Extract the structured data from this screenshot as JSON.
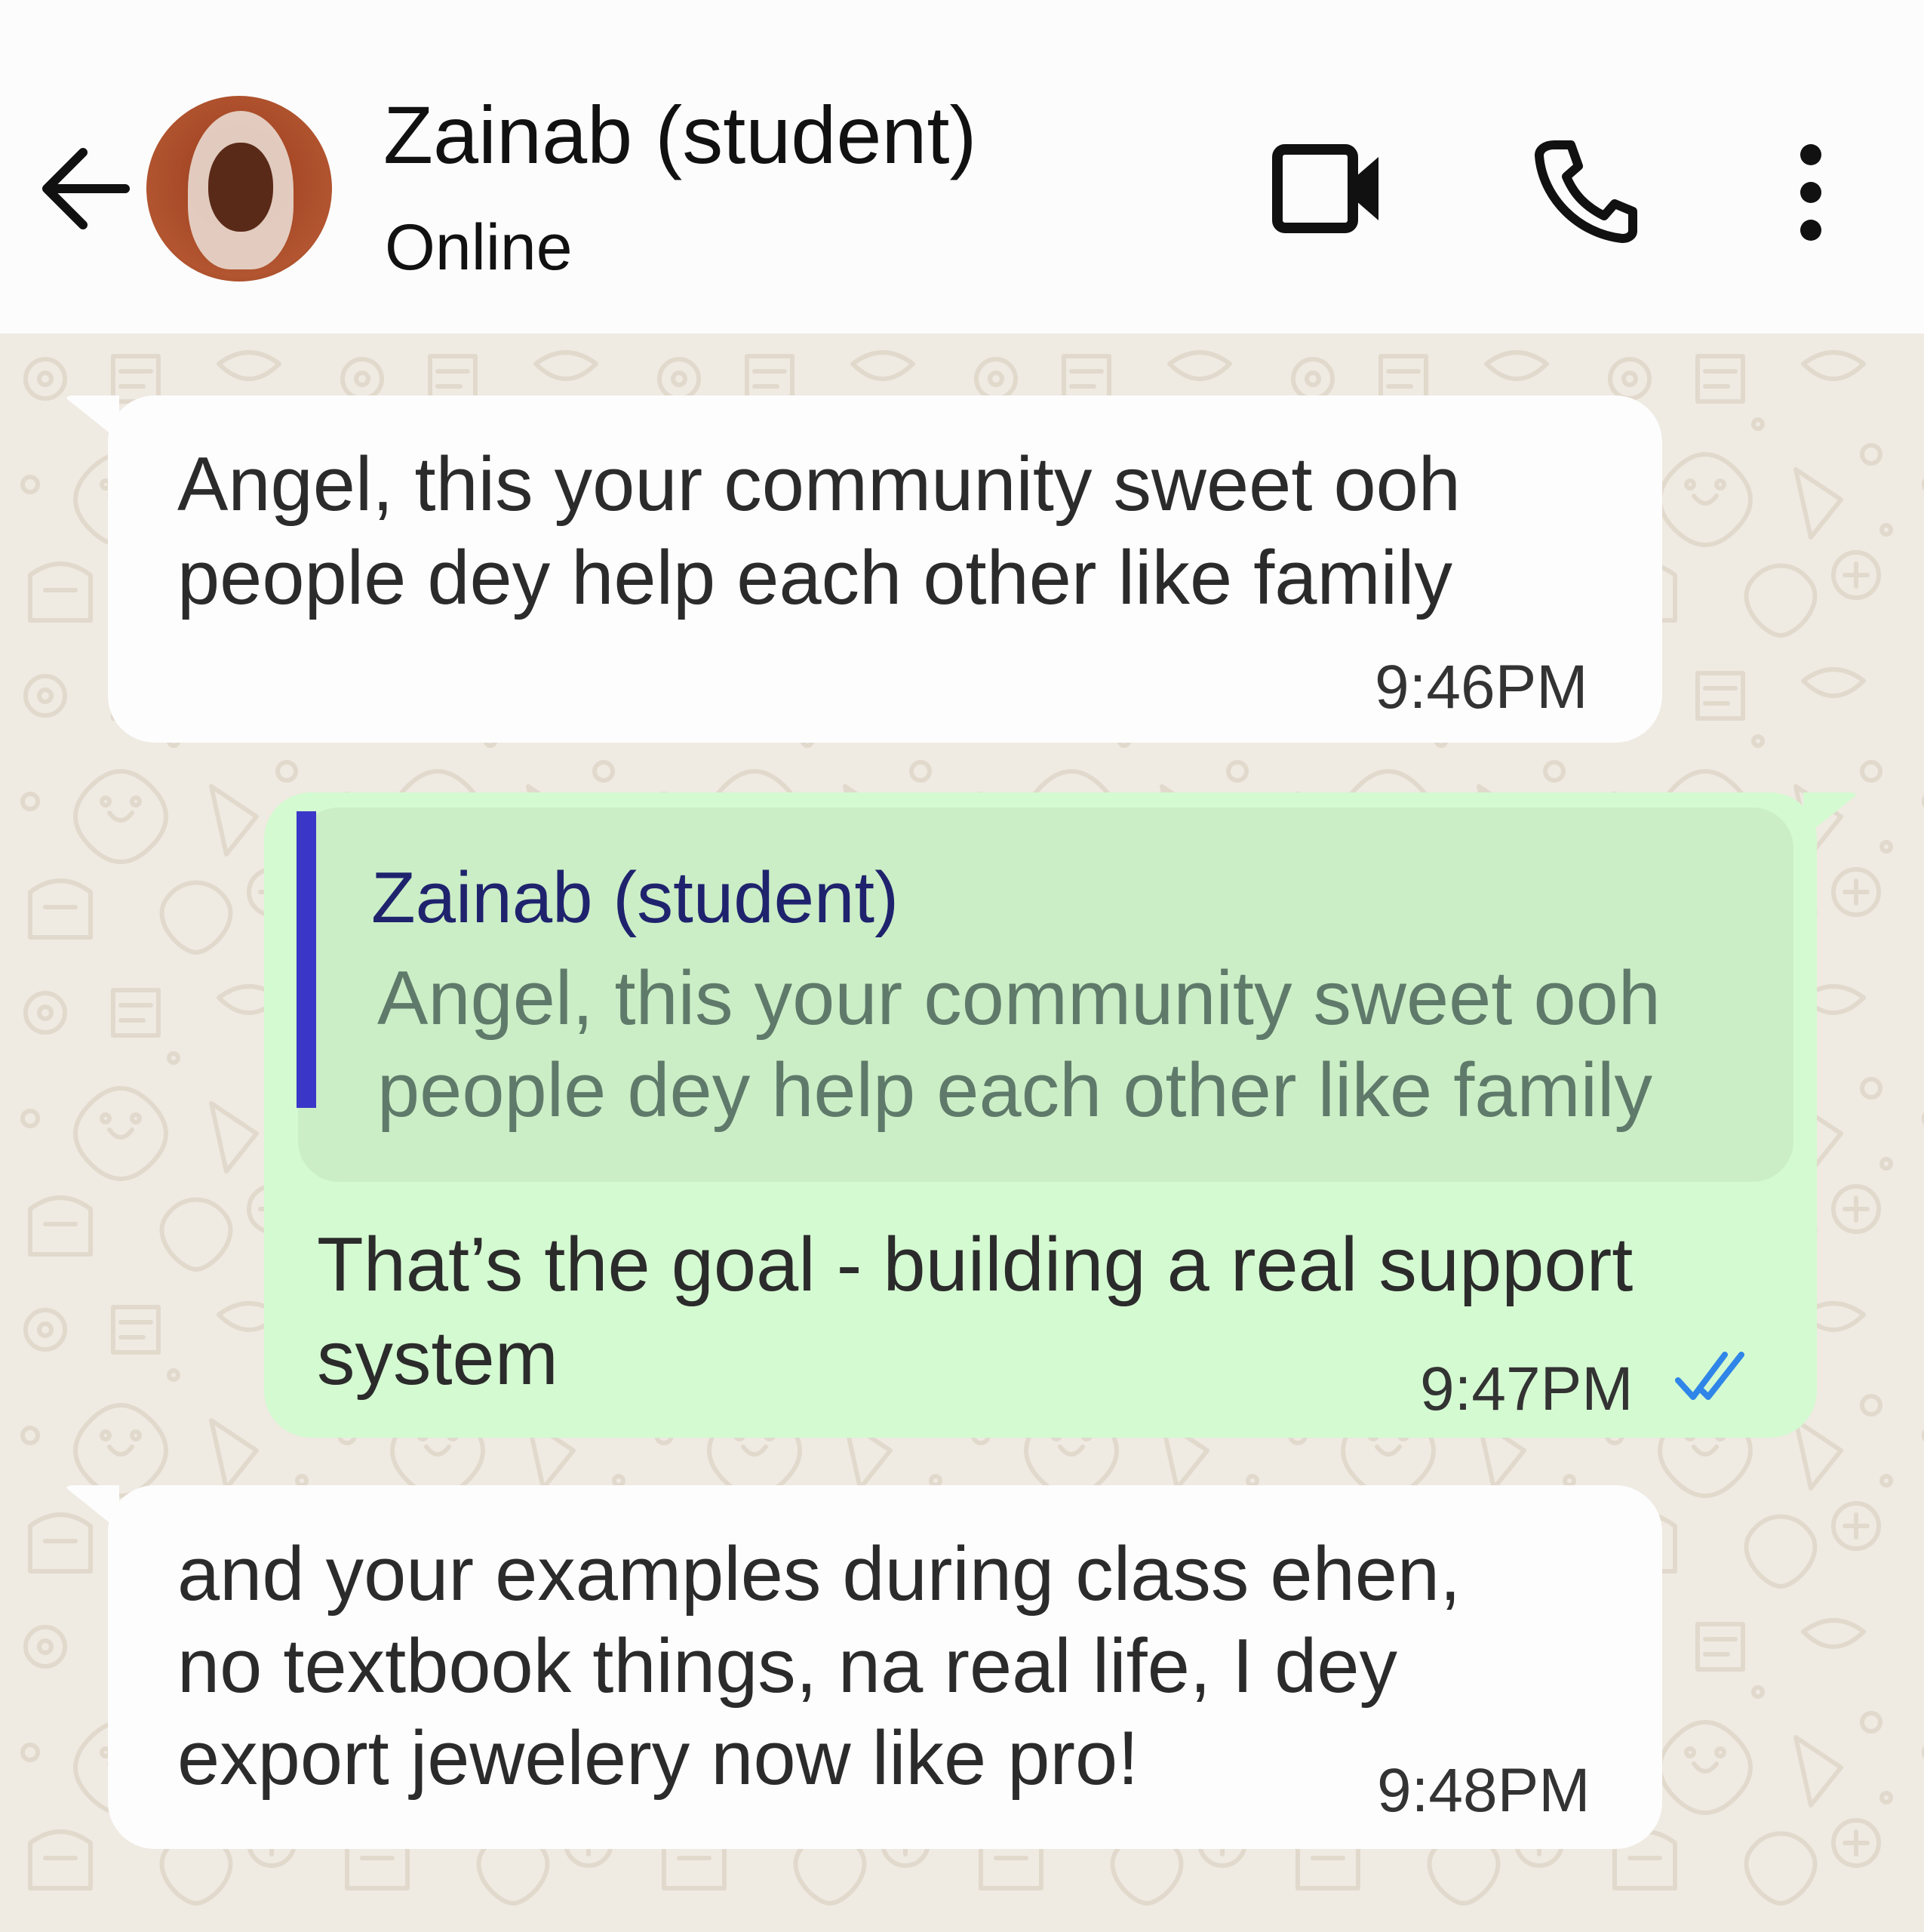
{
  "header": {
    "back_icon": "arrow-left-icon",
    "contact_name": "Zainab (student)",
    "status": "Online",
    "video_icon": "video-camera-icon",
    "call_icon": "phone-icon",
    "menu_icon": "more-vertical-icon"
  },
  "messages": [
    {
      "direction": "incoming",
      "lines": [
        "Angel, this your community sweet ooh",
        "people dey help each other like family"
      ],
      "time": "9:46PM"
    },
    {
      "direction": "outgoing",
      "quote": {
        "author": "Zainab (student)",
        "lines": [
          "Angel, this your community sweet ooh",
          "people dey help each other like family"
        ]
      },
      "lines": [
        "That’s the goal - building a real support",
        "system"
      ],
      "time": "9:47PM",
      "read_receipt": "double-check-icon"
    },
    {
      "direction": "incoming",
      "lines": [
        "and your examples during class ehen,",
        "no textbook things, na real life, I dey",
        "export jewelery now like pro!"
      ],
      "time": "9:48PM"
    }
  ],
  "colors": {
    "incoming_bubble": "#fdfdfd",
    "outgoing_bubble": "#d4fad1",
    "quote_background": "#cbeec6",
    "quote_bar": "#3a37c8",
    "quote_author": "#1f236d",
    "read_receipt": "#2f86e8",
    "wallpaper": "#efeae2"
  }
}
